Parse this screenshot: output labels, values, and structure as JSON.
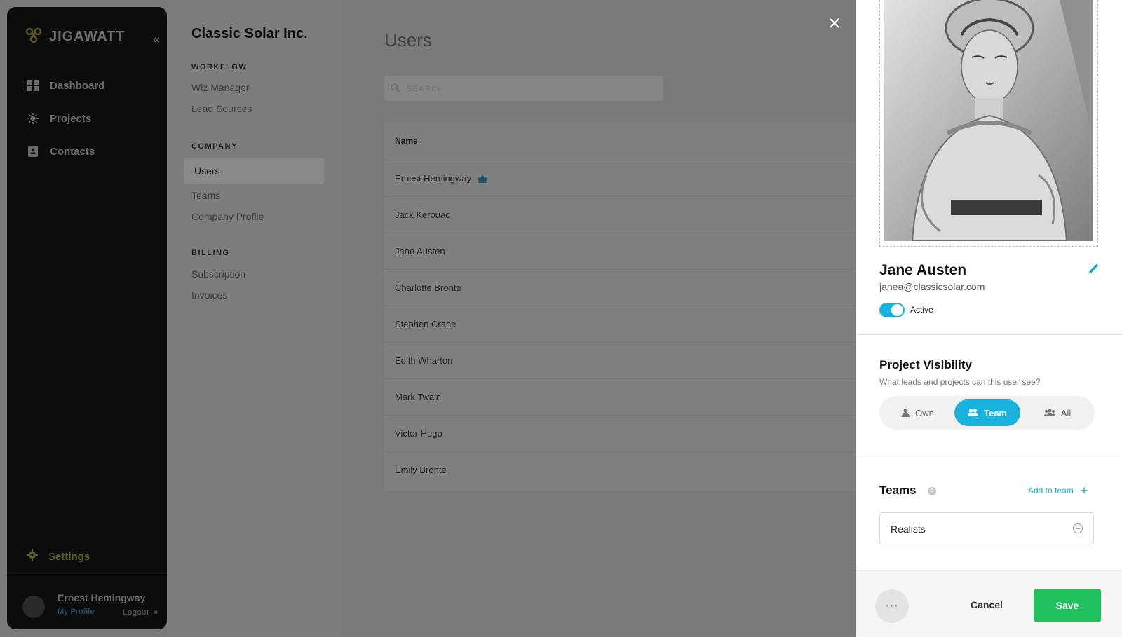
{
  "app": {
    "brand": "JIGAWATT",
    "collapse_icon": "double-chevron-left-icon",
    "nav": [
      {
        "label": "Dashboard",
        "icon": "grid-icon"
      },
      {
        "label": "Projects",
        "icon": "sun-icon"
      },
      {
        "label": "Contacts",
        "icon": "contact-book-icon"
      }
    ],
    "settings_label": "Settings",
    "user": {
      "name": "Ernest Hemingway",
      "profile_link": "My Profile",
      "logout_label": "Logout"
    }
  },
  "subnav": {
    "company": "Classic Solar Inc.",
    "sections": [
      {
        "heading": "WORKFLOW",
        "links": [
          "Wiz Manager",
          "Lead Sources"
        ]
      },
      {
        "heading": "COMPANY",
        "links": [
          "Users",
          "Teams",
          "Company Profile"
        ]
      },
      {
        "heading": "BILLING",
        "links": [
          "Subscription",
          "Invoices"
        ]
      }
    ],
    "active": "Users"
  },
  "users": {
    "title": "Users",
    "search_placeholder": "SEARCH",
    "column_name": "Name",
    "rows": [
      "Ernest Hemingway",
      "Jack Kerouac",
      "Jane Austen",
      "Charlotte Bronte",
      "Stephen Crane",
      "Edith Wharton",
      "Mark Twain",
      "Victor Hugo",
      "Emily Bronte"
    ],
    "owner_badge": "crown-icon"
  },
  "detail": {
    "name": "Jane Austen",
    "email": "janea@classicsolar.com",
    "status_label": "Active",
    "status_on": true,
    "visibility": {
      "title": "Project Visibility",
      "hint": "What leads and projects can this user see?",
      "options": [
        "Own",
        "Team",
        "All"
      ],
      "selected": "Team"
    },
    "teams": {
      "title": "Teams",
      "add_label": "Add to team",
      "items": [
        "Realists"
      ]
    },
    "footer": {
      "more": "···",
      "cancel": "Cancel",
      "save": "Save"
    }
  },
  "colors": {
    "accent": "#17b3dc",
    "save": "#21c25d",
    "settings_olive": "#5e5f1e"
  }
}
